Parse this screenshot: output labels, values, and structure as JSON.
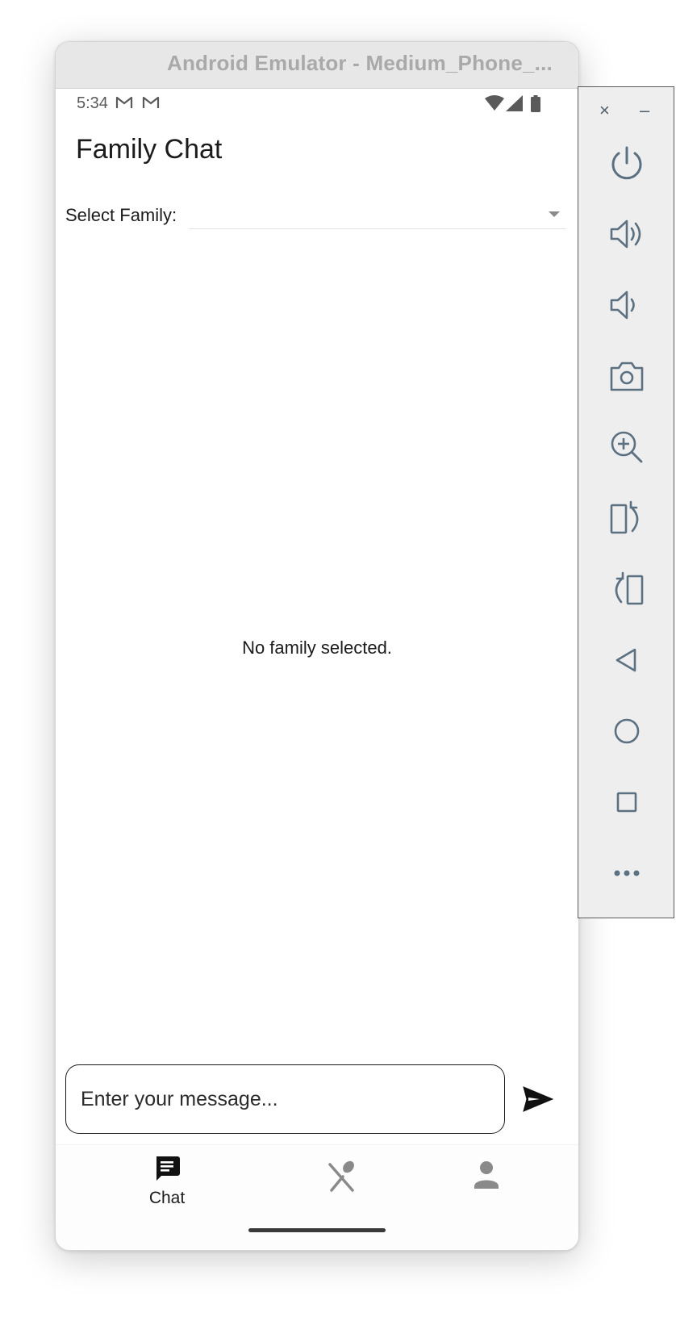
{
  "emulator": {
    "window_title": "Android Emulator - Medium_Phone_...",
    "close_glyph": "×",
    "minimize_glyph": "–"
  },
  "status_bar": {
    "time": "5:34",
    "icons": [
      "gmail-icon",
      "gmail-icon",
      "wifi-icon",
      "cell-signal-icon",
      "battery-icon"
    ]
  },
  "app_bar": {
    "title": "Family Chat"
  },
  "family_select": {
    "label": "Select Family:",
    "value": ""
  },
  "chat_area": {
    "empty_message": "No family selected."
  },
  "composer": {
    "placeholder": "Enter your message...",
    "value": ""
  },
  "bottom_nav": {
    "items": [
      {
        "icon": "chat-icon",
        "label": "Chat",
        "selected": true
      },
      {
        "icon": "restaurant-icon",
        "label": "",
        "selected": false
      },
      {
        "icon": "person-icon",
        "label": "",
        "selected": false
      }
    ]
  },
  "side_toolbar": {
    "buttons": [
      "power-icon",
      "volume-up-icon",
      "volume-down-icon",
      "camera-icon",
      "zoom-in-icon",
      "rotate-left-icon",
      "rotate-right-icon",
      "back-icon",
      "home-icon",
      "overview-icon",
      "more-icon"
    ]
  },
  "colors": {
    "toolbar_icon": "#5b7080",
    "text": "#1b1b1b",
    "titlebar_bg": "#e7e7e7",
    "titlebar_text": "#a9a9a9",
    "nav_inactive": "#8a8a8a"
  }
}
